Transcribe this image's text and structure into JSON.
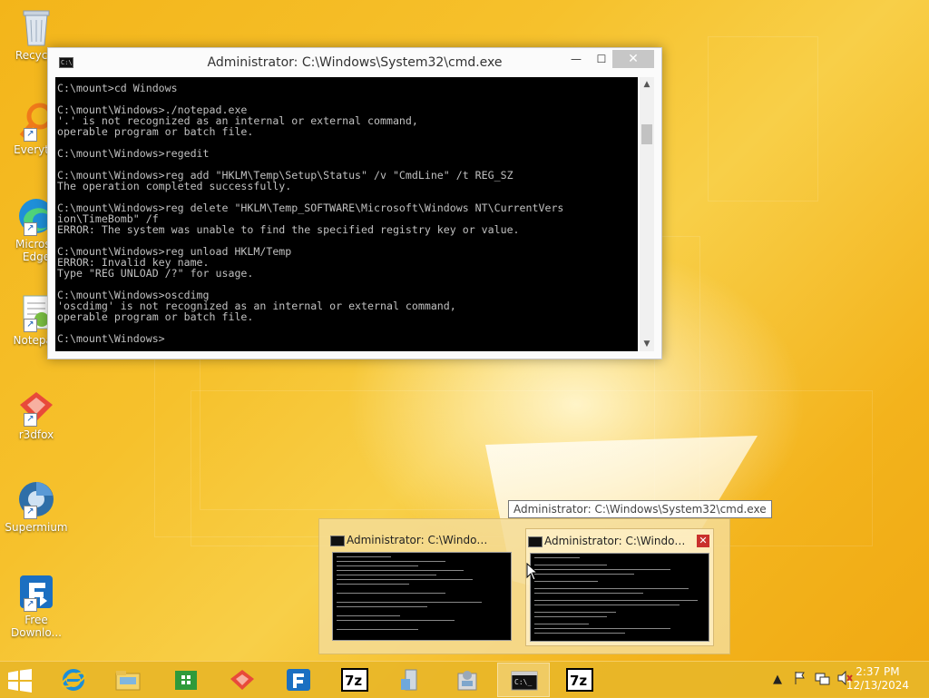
{
  "desktop": {
    "icons": [
      {
        "label": "Recycle"
      },
      {
        "label": "Everythi"
      },
      {
        "label": "Microso\nEdge"
      },
      {
        "label": "Notepad"
      },
      {
        "label": "r3dfox"
      },
      {
        "label": "Supermium"
      },
      {
        "label": "Free\nDownlo..."
      }
    ]
  },
  "cmd": {
    "title": "Administrator: C:\\Windows\\System32\\cmd.exe",
    "buttons": {
      "minimize": "—",
      "maximize": "☐",
      "close": "✕"
    },
    "lines": [
      "C:\\mount>cd Windows",
      "",
      "C:\\mount\\Windows>./notepad.exe",
      "'.' is not recognized as an internal or external command,",
      "operable program or batch file.",
      "",
      "C:\\mount\\Windows>regedit",
      "",
      "C:\\mount\\Windows>reg add \"HKLM\\Temp\\Setup\\Status\" /v \"CmdLine\" /t REG_SZ",
      "The operation completed successfully.",
      "",
      "C:\\mount\\Windows>reg delete \"HKLM\\Temp_SOFTWARE\\Microsoft\\Windows NT\\CurrentVers",
      "ion\\TimeBomb\" /f",
      "ERROR: The system was unable to find the specified registry key or value.",
      "",
      "C:\\mount\\Windows>reg unload HKLM/Temp",
      "ERROR: Invalid key name.",
      "Type \"REG UNLOAD /?\" for usage.",
      "",
      "C:\\mount\\Windows>oscdimg",
      "'oscdimg' is not recognized as an internal or external command,",
      "operable program or batch file.",
      "",
      "C:\\mount\\Windows>"
    ]
  },
  "tooltip": {
    "text": "Administrator: C:\\Windows\\System32\\cmd.exe"
  },
  "flyout": {
    "thumbnails": [
      {
        "title": "Administrator: C:\\Windows\\syst..."
      },
      {
        "title": "Administrator: C:\\Windows\\...",
        "close": "✕"
      }
    ]
  },
  "taskbar": {
    "apps": [
      "start",
      "internet-explorer",
      "file-explorer",
      "store",
      "r3dfox",
      "free-download-manager",
      "7zip",
      "notepad-installer",
      "installer",
      "cmd",
      "7zip-2"
    ],
    "tray": {
      "chevron": "▲",
      "time": "2:37 PM",
      "date": "12/13/2024"
    }
  },
  "colors": {
    "accent": "#f3b51a",
    "console_bg": "#000000",
    "console_fg": "#c0c0c0"
  }
}
